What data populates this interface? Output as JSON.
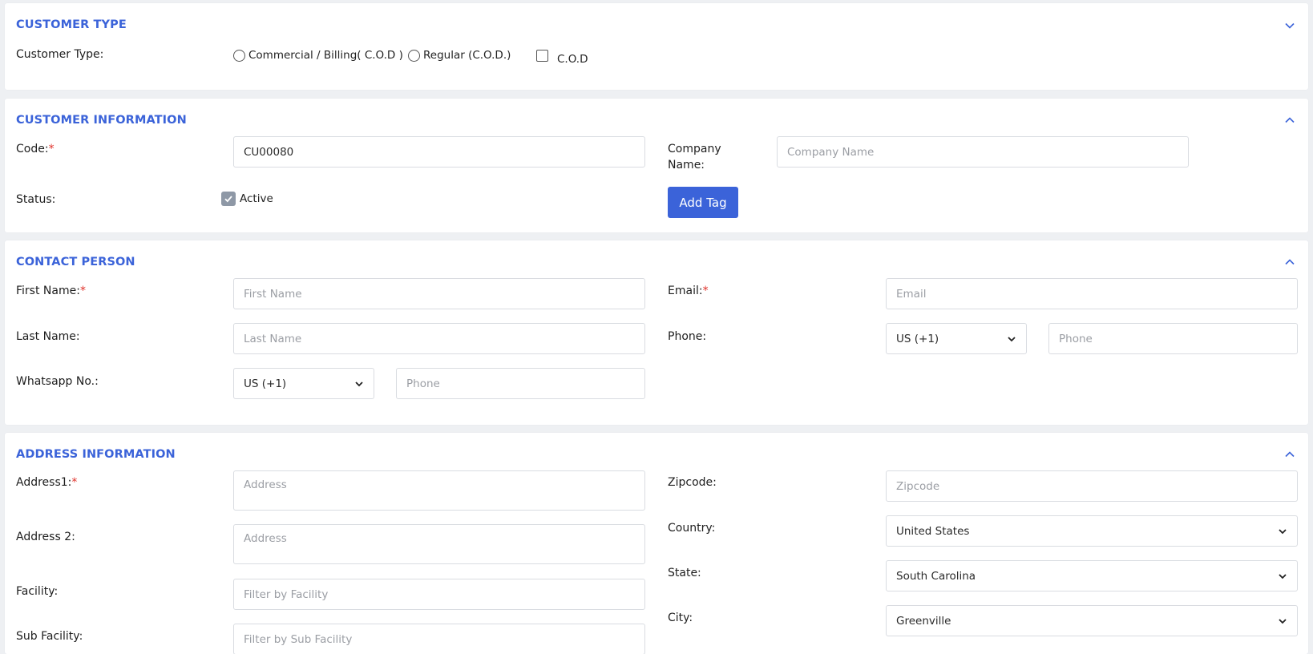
{
  "colors": {
    "accent": "#3b63d9",
    "required": "#e0322b"
  },
  "customer_type": {
    "title": "CUSTOMER TYPE",
    "label": "Customer Type:",
    "options": [
      "Commercial / Billing( C.O.D )",
      "Regular (C.O.D.)"
    ],
    "cod_label": "C.O.D"
  },
  "customer_info": {
    "title": "CUSTOMER INFORMATION",
    "code_label": "Code:",
    "code_value": "CU00080",
    "company_label_1": "Company",
    "company_label_2": "Name:",
    "company_placeholder": "Company Name",
    "status_label": "Status:",
    "active_label": "Active",
    "add_tag": "Add Tag"
  },
  "contact": {
    "title": "CONTACT PERSON",
    "first_label": "First Name:",
    "first_placeholder": "First Name",
    "last_label": "Last Name:",
    "last_placeholder": "Last Name",
    "whatsapp_label": "Whatsapp No.:",
    "whatsapp_code": "US (+1)",
    "whatsapp_placeholder": "Phone",
    "email_label": "Email:",
    "email_placeholder": "Email",
    "phone_label": "Phone:",
    "phone_code": "US (+1)",
    "phone_placeholder": "Phone"
  },
  "address": {
    "title": "ADDRESS INFORMATION",
    "addr1_label": "Address1:",
    "addr1_placeholder": "Address",
    "addr2_label": "Address 2:",
    "addr2_placeholder": "Address",
    "facility_label": "Facility:",
    "facility_placeholder": "Filter by Facility",
    "subfacility_label": "Sub Facility:",
    "subfacility_placeholder": "Filter by Sub Facility",
    "zip_label": "Zipcode:",
    "zip_placeholder": "Zipcode",
    "country_label": "Country:",
    "country_value": "United States",
    "state_label": "State:",
    "state_value": "South Carolina",
    "city_label": "City:",
    "city_value": "Greenville"
  },
  "required_mark": "*"
}
